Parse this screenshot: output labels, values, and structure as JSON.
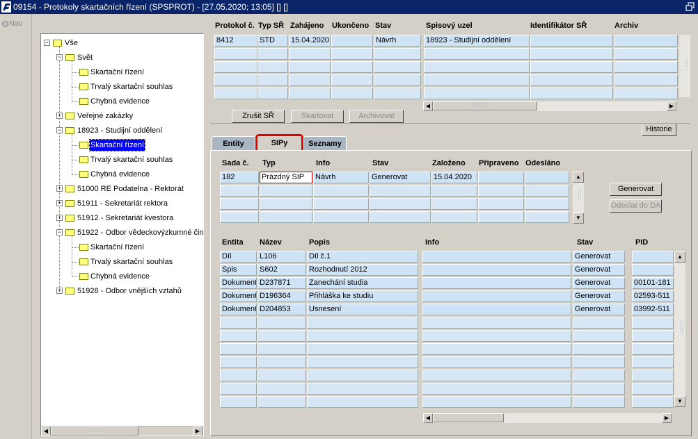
{
  "window": {
    "title": "09154 - Protokoly skartačních řízení (SPSPROT) - [27.05.2020; 13:05] [] []"
  },
  "nav": {
    "label": "Nav"
  },
  "tree": [
    {
      "label": "Vše",
      "expander": "−"
    },
    {
      "label": "Svět",
      "expander": "−"
    },
    {
      "label": "Skartační řízení"
    },
    {
      "label": "Trvalý skartační souhlas"
    },
    {
      "label": "Chybná evidence"
    },
    {
      "label": "Veřejné zakázky",
      "expander": "+"
    },
    {
      "label": "18923 - Studijní oddělení",
      "expander": "−"
    },
    {
      "label": "Skartační řízení",
      "selected": true
    },
    {
      "label": "Trvalý skartační souhlas"
    },
    {
      "label": "Chybná evidence"
    },
    {
      "label": "51000 RE Podatelna - Rektorát",
      "expander": "+"
    },
    {
      "label": "51911 - Sekretariát rektora",
      "expander": "+"
    },
    {
      "label": "51912 - Sekretariát kvestora",
      "expander": "+"
    },
    {
      "label": "51922 - Odbor vědeckovýzkumné čin",
      "expander": "−"
    },
    {
      "label": "Skartační řízení"
    },
    {
      "label": "Trvalý skartační souhlas"
    },
    {
      "label": "Chybná evidence"
    },
    {
      "label": "51926 - Odbor vnějších vztahů",
      "expander": "+"
    }
  ],
  "protocols": {
    "headers": [
      "Protokol č.",
      "Typ SŘ",
      "Zahájeno",
      "Ukončeno",
      "Stav",
      "Spisový uzel",
      "Identifikátor SŘ",
      "Archiv"
    ],
    "rows": [
      [
        "8412",
        "STD",
        "15.04.2020",
        "",
        "Návrh",
        "18923 - Studijní oddělení",
        "",
        ""
      ]
    ]
  },
  "buttons": {
    "cancel": "Zrušit SŘ",
    "shred": "Skartovat",
    "archive": "Archivovat",
    "history": "Historie",
    "generate": "Generovat",
    "send": "Odeslat do DA"
  },
  "tabs": [
    "Entity",
    "SIPy",
    "Seznamy"
  ],
  "sips": {
    "headers": [
      "Sada č.",
      "Typ",
      "Info",
      "Stav",
      "Založeno",
      "Připraveno",
      "Odesláno"
    ],
    "rows": [
      [
        "182",
        "Prázdný SIP",
        "Návrh",
        "Generovat",
        "15.04.2020",
        "",
        ""
      ]
    ]
  },
  "entities": {
    "headers": [
      "Entita",
      "Název",
      "Popis",
      "Info",
      "Stav",
      "PID"
    ],
    "rows": [
      [
        "Díl",
        "L106",
        "Díl č.1",
        "",
        "Generovat",
        ""
      ],
      [
        "Spis",
        "S602",
        "Rozhodnutí 2012",
        "",
        "Generovat",
        ""
      ],
      [
        "Dokument",
        "D237871",
        "Zanechání studia",
        "",
        "Generovat",
        "00101-181"
      ],
      [
        "Dokument",
        "D196364",
        "Přihláška ke studiu",
        "",
        "Generovat",
        "02593-511"
      ],
      [
        "Dokument",
        "D204853",
        "Usnesení",
        "",
        "Generovat",
        "03992-511"
      ]
    ]
  }
}
